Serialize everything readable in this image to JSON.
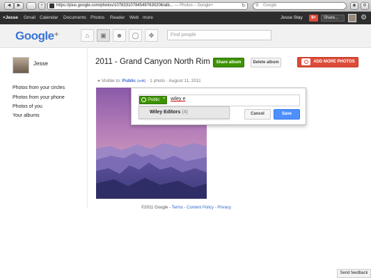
{
  "browser": {
    "url_main": "https://plus.google.com/photos/107833107845497630206/alb...",
    "url_tail": " — Photos – Google+",
    "search_placeholder": "Google",
    "back_label": "◀",
    "forward_label": "▶",
    "add_label": "+",
    "reload_icon": "↻"
  },
  "gbar": {
    "items": [
      "+Jesse",
      "Gmail",
      "Calendar",
      "Documents",
      "Photos",
      "Reader",
      "Web",
      "more"
    ],
    "user": "Jesse Stay",
    "notifications": "9+",
    "share_label": "Share..."
  },
  "header": {
    "logo_text": "Google",
    "logo_plus": "+",
    "find_people_placeholder": "Find people",
    "nav_icons": [
      "home-icon",
      "photos-icon",
      "profile-icon",
      "circles-icon",
      "games-icon"
    ]
  },
  "sidebar": {
    "name": "Jesse",
    "links": [
      "Photos from your circles",
      "Photos from your phone",
      "Photos of you",
      "Your albums"
    ]
  },
  "album": {
    "title": "2011 - Grand Canyon North Rim",
    "share_button": "Share album",
    "delete_button": "Delete album",
    "add_button": "ADD MORE PHOTOS",
    "visible_prefix": "Visible to:",
    "visibility": "Public",
    "edit_label": "(edit)",
    "photo_count": "1 photo",
    "date": "August 11, 2011"
  },
  "share_dialog": {
    "chip_label": "Public",
    "typed_text": "wiley e",
    "suggestion_name": "Wiley Editors",
    "suggestion_count": "(4)",
    "cancel_label": "Cancel",
    "save_label": "Save"
  },
  "footer": {
    "copyright": "©2011 Google",
    "terms": "Terms",
    "policy": "Content Policy",
    "privacy": "Privacy"
  },
  "feedback_label": "Send feedback",
  "colors": {
    "gbar_bg": "#2d2d2d",
    "share_green": "#3d9400",
    "add_red": "#dd4b39",
    "save_blue": "#4d90fe",
    "link_blue": "#3366cc"
  }
}
